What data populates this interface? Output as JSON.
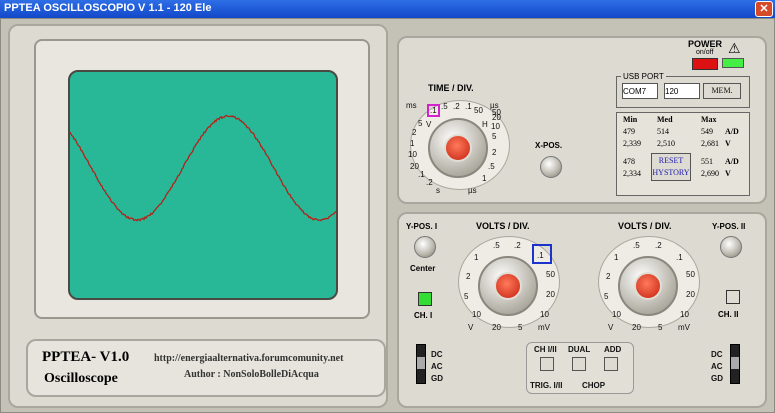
{
  "window": {
    "title": "PPTEA OSCILLOSCOPIO  V 1.1 - 120 Ele"
  },
  "time_div": {
    "title": "TIME / DIV.",
    "labels": [
      "ms",
      ".1",
      ".5",
      ".2",
      ".1",
      "µs",
      "5",
      "V",
      "2",
      "1",
      "H",
      "10",
      "20",
      "50",
      ".1",
      ".2",
      "s",
      "50",
      "10",
      "20",
      "5",
      "2",
      ".5",
      "1",
      "µs"
    ]
  },
  "xpos": {
    "label": "X-POS."
  },
  "power": {
    "label": "POWER",
    "sub": "on/off"
  },
  "usb": {
    "label": "USB PORT",
    "port": "COM7",
    "value": "120",
    "mem": "MEM."
  },
  "stats": {
    "headers": [
      "Min",
      "Med",
      "Max"
    ],
    "rows": [
      [
        "479",
        "514",
        "549",
        "A/D"
      ],
      [
        "2,339",
        "2,510",
        "2,681",
        "V"
      ],
      [
        "478",
        "",
        "551",
        "A/D"
      ],
      [
        "2,334",
        "",
        "2,690",
        "V"
      ]
    ],
    "reset": "RESET HYSTORY"
  },
  "ch1": {
    "ypos": "Y-POS. I",
    "center": "Center",
    "label": "CH. I",
    "volts": "VOLTS / DIV."
  },
  "ch2": {
    "ypos": "Y-POS. II",
    "label": "CH. II",
    "volts": "VOLTS / DIV."
  },
  "volts_labels": [
    ".5",
    ".2",
    "1",
    ".1",
    "2",
    "50",
    "5",
    "20",
    "10",
    "10",
    "V",
    "20",
    "5",
    "mV"
  ],
  "bottom": {
    "ch12": "CH I/II",
    "dual": "DUAL",
    "add": "ADD",
    "trig": "TRIG. I/II",
    "chop": "CHOP"
  },
  "coupling": [
    "DC",
    "AC",
    "GD"
  ],
  "brand": {
    "name": "PPTEA- V1.0",
    "sub": "Oscilloscope",
    "url": "http://energiaalternativa.forumcomunity.net",
    "author": "Author :  NonSoloBolleDiAcqua"
  },
  "colors": {
    "screen": "#28b897",
    "trace": "#b3221a",
    "ch1_led": "#33dd33",
    "power_led": "#dd1111"
  }
}
